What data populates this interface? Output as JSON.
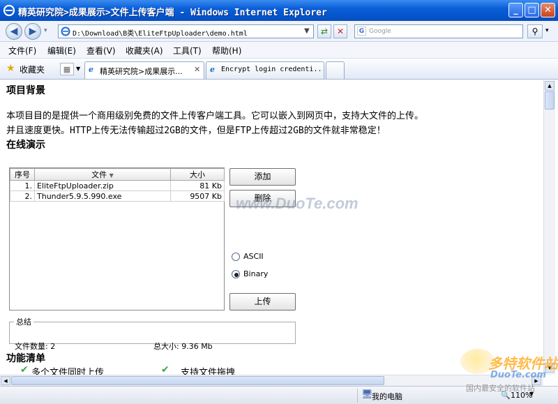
{
  "window": {
    "title": "精英研究院>成果展示>文件上传客户端 - Windows Internet Explorer",
    "address": "D:\\Download\\B类\\EliteFtpUploader\\demo.html",
    "search_placeholder": "Google"
  },
  "menu": [
    "文件(F)",
    "编辑(E)",
    "查看(V)",
    "收藏夹(A)",
    "工具(T)",
    "帮助(H)"
  ],
  "favorites_label": "收藏夹",
  "tabs": [
    {
      "label": "精英研究院>成果展示...",
      "active": true
    },
    {
      "label": "Encrypt login credenti...",
      "active": false
    }
  ],
  "page": {
    "section_background": "项目背景",
    "background_line1": "本项目目的是提供一个商用级别免费的文件上传客户端工具。它可以嵌入到网页中，支持大文件的上传。",
    "background_line2": "并且速度更快。HTTP上传无法传输超过2GB的文件，但是FTP上传超过2GB的文件就非常稳定！",
    "section_demo": "在线演示",
    "section_features": "功能清单",
    "features": [
      "多个文件同时上传",
      "支持文件拖拽"
    ]
  },
  "uploader": {
    "columns": [
      "序号",
      "文件",
      "大小"
    ],
    "files": [
      {
        "index": "1.",
        "name": "EliteFtpUploader.zip",
        "size": "81 Kb"
      },
      {
        "index": "2.",
        "name": "Thunder5.9.5.990.exe",
        "size": "9507 Kb"
      }
    ],
    "add_label": "添加",
    "delete_label": "删除",
    "ascii_label": "ASCII",
    "binary_label": "Binary",
    "upload_label": "上传",
    "summary_legend": "总结",
    "file_count": "文件数量: 2",
    "total_size": "总大小: 9.36 Mb"
  },
  "watermarks": {
    "center": "www.DuoTe.com",
    "corner_top": "多特软件站",
    "corner_bottom": "DuoTe.com",
    "corner_slogan": "国内最安全的软件站"
  },
  "status": {
    "zone": "我的电脑",
    "zoom": "110%"
  }
}
